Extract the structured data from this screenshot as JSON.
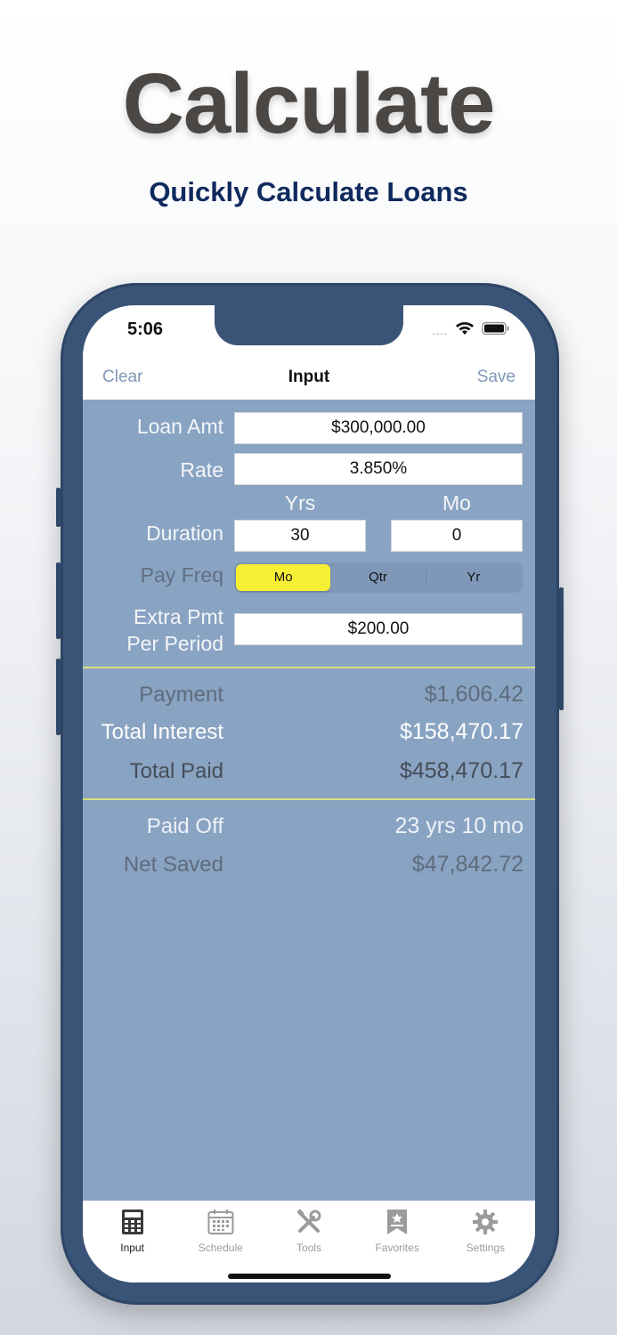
{
  "hero": {
    "title": "Calculate",
    "subtitle": "Quickly Calculate Loans"
  },
  "status": {
    "time": "5:06",
    "signal": "....",
    "icons": [
      "cellular-dots-icon",
      "wifi-icon",
      "battery-icon"
    ]
  },
  "nav": {
    "left": "Clear",
    "title": "Input",
    "right": "Save"
  },
  "form": {
    "loan_amt_label": "Loan Amt",
    "loan_amt_value": "$300,000.00",
    "rate_label": "Rate",
    "rate_value": "3.850%",
    "yrs_label": "Yrs",
    "mo_label": "Mo",
    "duration_label": "Duration",
    "duration_yrs": "30",
    "duration_mo": "0",
    "pay_freq_label": "Pay Freq",
    "pay_freq_options": [
      "Mo",
      "Qtr",
      "Yr"
    ],
    "pay_freq_selected": "Mo",
    "extra_pmt_label_1": "Extra Pmt",
    "extra_pmt_label_2": "Per Period",
    "extra_pmt_value": "$200.00"
  },
  "results": {
    "payment_label": "Payment",
    "payment_value": "$1,606.42",
    "total_interest_label": "Total Interest",
    "total_interest_value": "$158,470.17",
    "total_paid_label": "Total Paid",
    "total_paid_value": "$458,470.17",
    "paid_off_label": "Paid Off",
    "paid_off_value": "23 yrs 10 mo",
    "net_saved_label": "Net Saved",
    "net_saved_value": "$47,842.72"
  },
  "tabs": [
    {
      "label": "Input",
      "icon": "calculator-icon",
      "active": true
    },
    {
      "label": "Schedule",
      "icon": "calendar-icon",
      "active": false
    },
    {
      "label": "Tools",
      "icon": "tools-icon",
      "active": false
    },
    {
      "label": "Favorites",
      "icon": "bookmark-icon",
      "active": false
    },
    {
      "label": "Settings",
      "icon": "gear-icon",
      "active": false
    }
  ],
  "colors": {
    "accent_yellow": "#f7ef34",
    "panel_blue": "#89a3c2",
    "phone_frame": "#3a5478",
    "subtitle_navy": "#0f2a5e"
  }
}
